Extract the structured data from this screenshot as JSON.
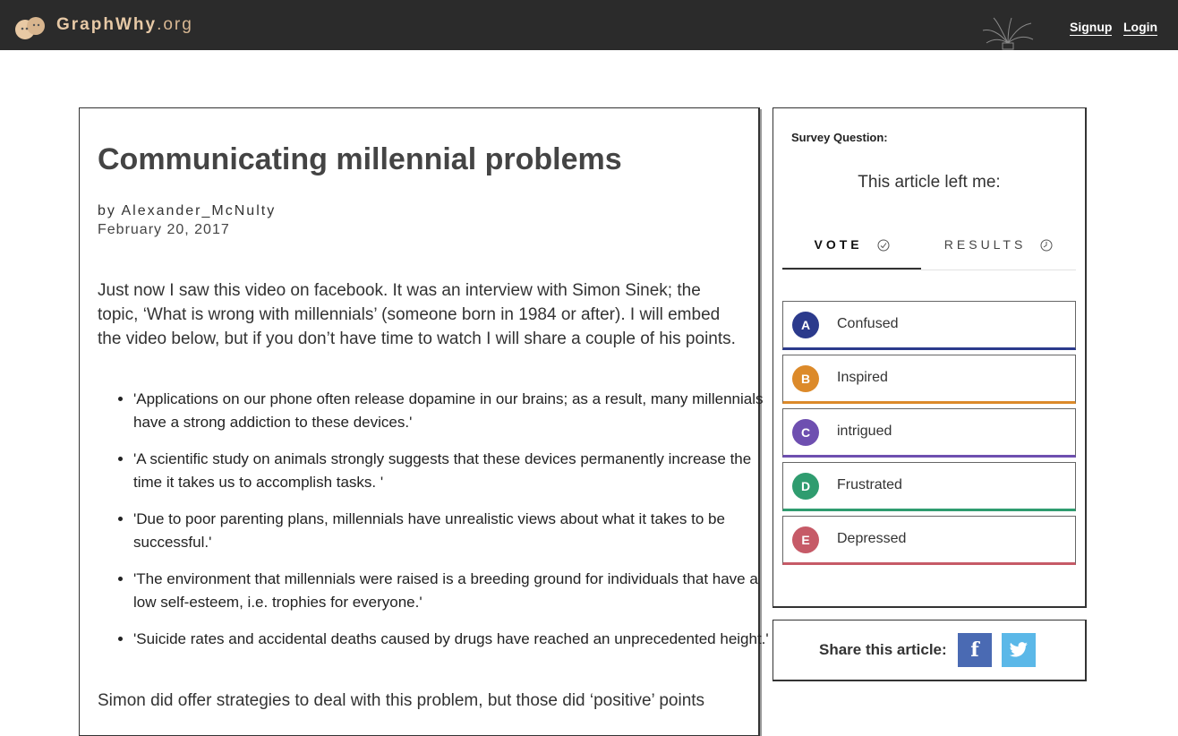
{
  "header": {
    "brand_bold": "GraphWhy",
    "brand_tld": ".org",
    "signup": "Signup",
    "login": "Login",
    "icons": [
      "graphwhy-logo-icon",
      "plant-icon"
    ]
  },
  "article": {
    "title": "Communicating millennial problems",
    "byline": "by Alexander_McNulty",
    "date": "February 20, 2017",
    "intro": "Just now I saw this video on facebook. It was an interview with Simon Sinek; the topic, ‘What is wrong with millennials’ (someone born in 1984 or after). I will embed the video below, but if you don’t have time to watch I will share a couple of his points.",
    "bullets": [
      "'Applications on our phone often release dopamine in our brains; as a result, many millennials have a strong addiction to these devices.'",
      "'A scientific study on animals strongly suggests that these devices permanently increase the time it takes us to accomplish tasks. '",
      "'Due to poor parenting plans, millennials have unrealistic views about what it takes to be successful.'",
      "'The environment that millennials were raised is a breeding ground for individuals that have a low self-esteem, i.e. trophies for everyone.'",
      "'Suicide rates and accidental deaths caused by drugs have reached an unprecedented height.'"
    ],
    "outro": "Simon did offer strategies to deal with this problem, but those did ‘positive’ points"
  },
  "survey": {
    "label": "Survey Question:",
    "question": "This article left me:",
    "tabs": {
      "vote": "VOTE",
      "results": "RESULTS"
    },
    "options": [
      {
        "letter": "A",
        "label": "Confused",
        "color": "#2b3a8c"
      },
      {
        "letter": "B",
        "label": "Inspired",
        "color": "#dc8a2a"
      },
      {
        "letter": "C",
        "label": "intrigued",
        "color": "#6e4fb0"
      },
      {
        "letter": "D",
        "label": "Frustrated",
        "color": "#2f9c6f"
      },
      {
        "letter": "E",
        "label": "Depressed",
        "color": "#c65a67"
      }
    ]
  },
  "share": {
    "label": "Share this article:",
    "facebook": "f",
    "colors": {
      "facebook": "#4a6ab3",
      "twitter": "#5bb8e8"
    }
  }
}
